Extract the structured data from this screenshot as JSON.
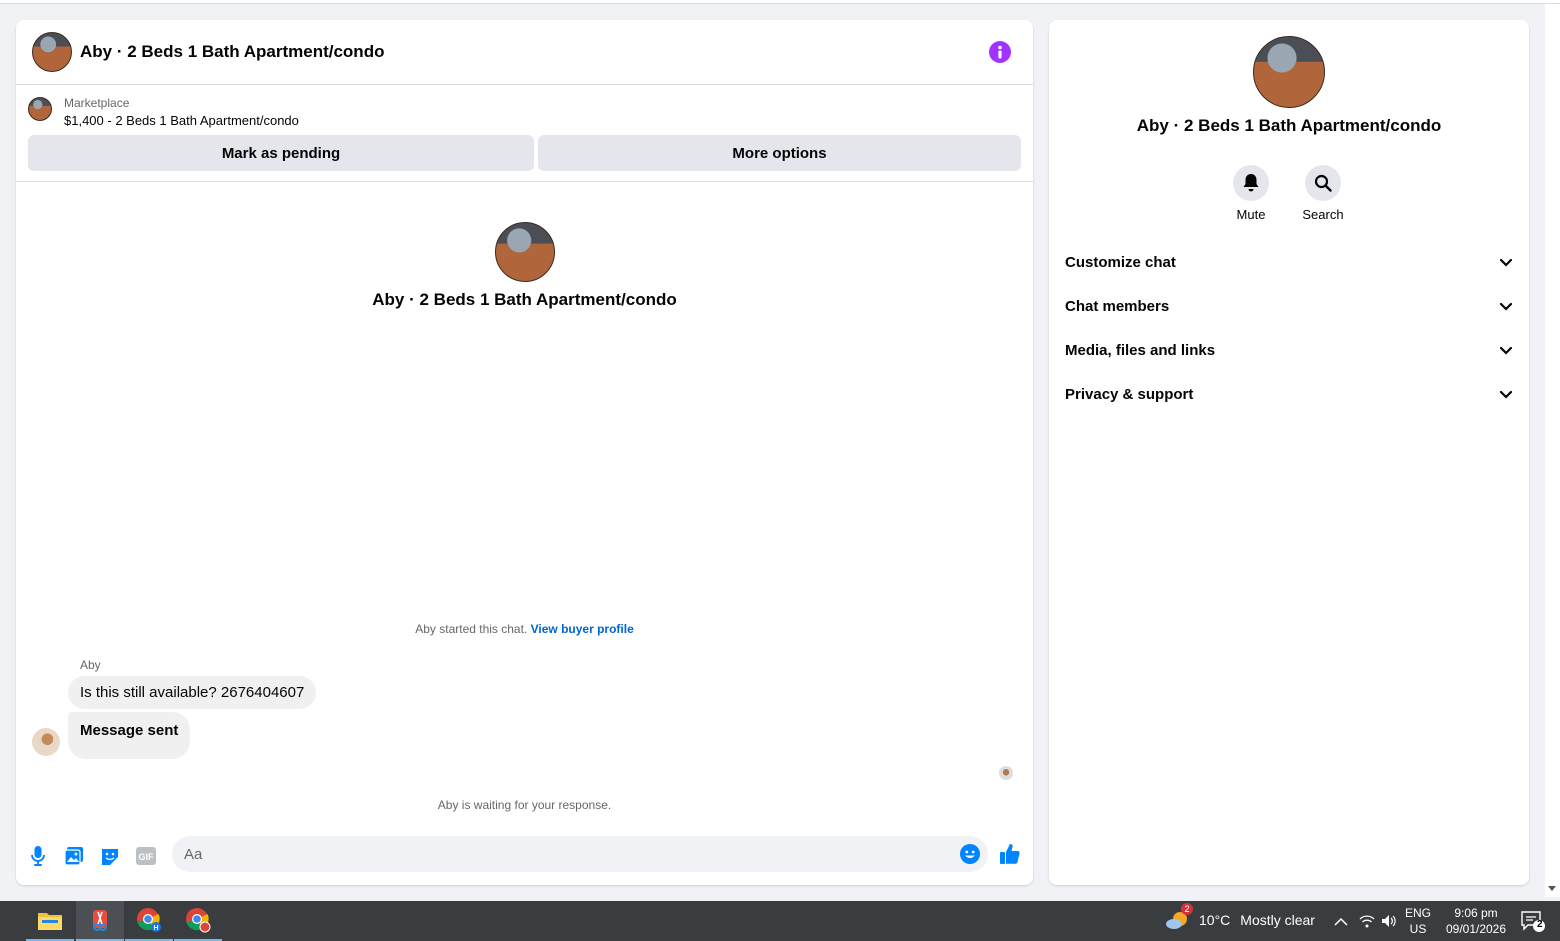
{
  "chat": {
    "header_title": "Aby · 2 Beds 1 Bath Apartment/condo",
    "listing_kicker": "Marketplace",
    "listing_title": "$1,400 - 2 Beds 1 Bath Apartment/condo",
    "btn_pending": "Mark as pending",
    "btn_more": "More options",
    "intro_name": "Aby · 2 Beds 1 Bath Apartment/condo",
    "started_text": "Aby started this chat.",
    "view_buyer_profile": "View buyer profile",
    "sender_name": "Aby",
    "messages": [
      {
        "text": "Is this still available? 2676404607"
      },
      {
        "text": "Message sent"
      }
    ],
    "waiting_text": "Aby is waiting for your response.",
    "composer_placeholder": "Aa"
  },
  "details": {
    "name": "Aby · 2 Beds 1 Bath Apartment/condo",
    "actions": [
      {
        "label": "Mute",
        "icon": "bell-icon"
      },
      {
        "label": "Search",
        "icon": "search-icon"
      }
    ],
    "sections": [
      {
        "label": "Customize chat"
      },
      {
        "label": "Chat members"
      },
      {
        "label": "Media, files and links"
      },
      {
        "label": "Privacy & support"
      }
    ]
  },
  "taskbar": {
    "weather_temp": "10°C",
    "weather_desc": "Mostly clear",
    "weather_badge": "2",
    "lang_top": "ENG",
    "lang_bottom": "US",
    "time": "9:06 pm",
    "date": "09/01/2026",
    "notif_count": "2",
    "chrome_badge": "H"
  },
  "colors": {
    "accent": "#0084ff",
    "info_purple": "#a033ff",
    "link": "#0064d1"
  }
}
